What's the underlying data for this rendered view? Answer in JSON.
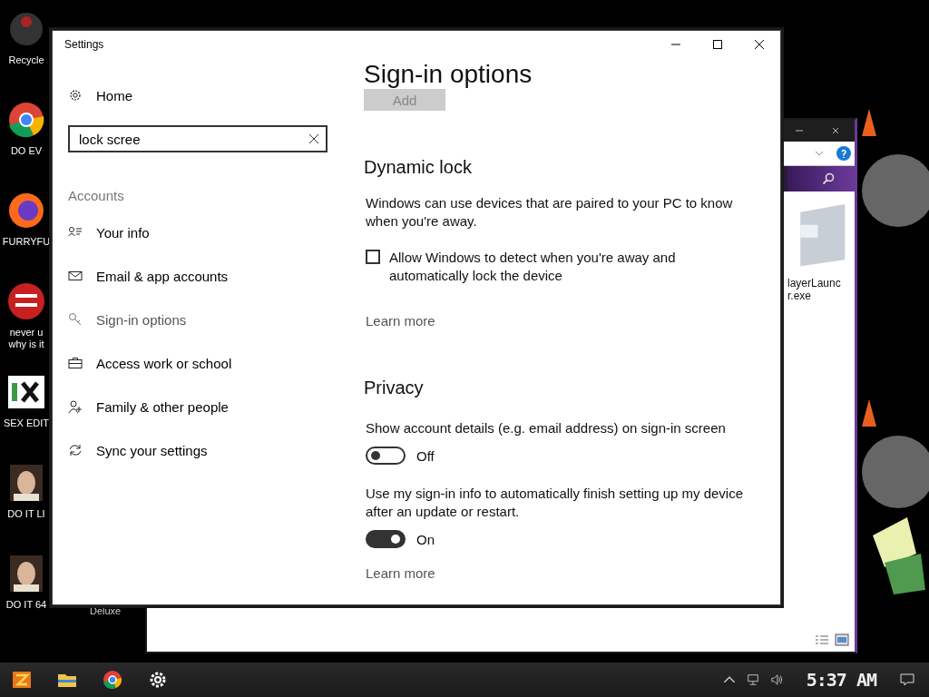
{
  "desktop_icons": [
    {
      "kind": "bin",
      "lines": [
        "Recycle"
      ]
    },
    {
      "kind": "chrome",
      "lines": [
        "DO EV"
      ]
    },
    {
      "kind": "firefox",
      "lines": [
        "FURRYFU"
      ]
    },
    {
      "kind": "devcpp",
      "lines": [
        "never u",
        "why is it"
      ]
    },
    {
      "kind": "hex",
      "lines": [
        "SEX EDIT"
      ]
    },
    {
      "kind": "portrait",
      "lines": [
        "DO IT LI"
      ]
    },
    {
      "kind": "portrait",
      "lines": [
        "DO IT 64"
      ]
    }
  ],
  "desktop_label": "Deluxe",
  "explorer_window": {
    "file_lines": [
      "layerLaunc",
      "r.exe"
    ]
  },
  "settings": {
    "title": "Settings",
    "home": "Home",
    "search": {
      "value": "lock scree"
    },
    "section": "Accounts",
    "nav": [
      {
        "label": "Your info",
        "selected": false
      },
      {
        "label": "Email & app accounts",
        "selected": false
      },
      {
        "label": "Sign-in options",
        "selected": true
      },
      {
        "label": "Access work or school",
        "selected": false
      },
      {
        "label": "Family & other people",
        "selected": false
      },
      {
        "label": "Sync your settings",
        "selected": false
      }
    ],
    "page_title": "Sign-in options",
    "add_button": {
      "label": "Add",
      "disabled": true
    },
    "dynamic_lock": {
      "heading": "Dynamic lock",
      "text": "Windows can use devices that are paired to your PC to know when you're away.",
      "checkbox": {
        "label": "Allow Windows to detect when you're away and automatically lock the device",
        "checked": false
      },
      "link": "Learn more"
    },
    "privacy": {
      "heading": "Privacy",
      "toggles": [
        {
          "label": "Show account details (e.g. email address) on sign-in screen",
          "on": false,
          "state": "Off"
        },
        {
          "label": "Use my sign-in info to automatically finish setting up my device after an update or restart.",
          "on": true,
          "state": "On"
        }
      ],
      "link": "Learn more"
    }
  },
  "taskbar": {
    "clock": "5:37 AM"
  }
}
